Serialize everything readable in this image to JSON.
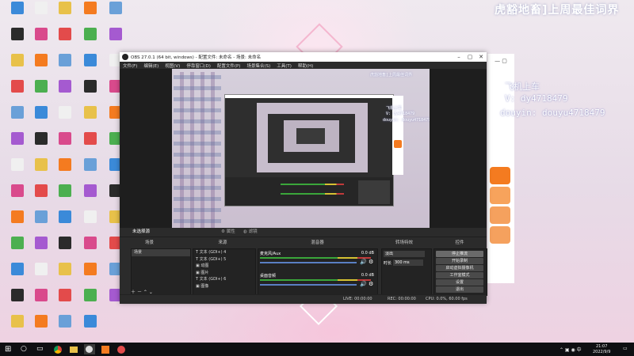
{
  "stream_overlay": {
    "title": "虎豁地畜]上周最佳词界",
    "line1": "飞机上车",
    "line2": "V: dy4718479",
    "line3": "douyin: douyu4718479"
  },
  "desktop_icons": [
    {
      "label": "",
      "icon": "computer-icon",
      "color": "#6aa0d8"
    },
    {
      "label": "",
      "icon": "mail-icon",
      "color": "#3b8ad9"
    },
    {
      "label": "",
      "icon": "file-icon",
      "color": "#f3f3f3"
    },
    {
      "label": "",
      "icon": "app-icon",
      "color": "#e34b4b"
    },
    {
      "label": "",
      "icon": "app-icon",
      "color": "#3a7ad1"
    },
    {
      "label": "",
      "icon": "app-icon",
      "color": "#f0f0f0"
    },
    {
      "label": "",
      "icon": "folder-icon",
      "color": "#e8c14a"
    },
    {
      "label": "",
      "icon": "app-icon",
      "color": "#4caf50"
    },
    {
      "label": "",
      "icon": "app-icon",
      "color": "#ffffff"
    },
    {
      "label": "",
      "icon": "app-icon",
      "color": "#888888"
    },
    {
      "label": "",
      "icon": "app-icon",
      "color": "#e05a5a"
    },
    {
      "label": "",
      "icon": "app-icon",
      "color": "#a55ad0"
    }
  ],
  "obs": {
    "title": "OBS 27.0.1 (64 bit, windows) - 配置文件: 未命名 - 场景: 未命名",
    "menu": [
      "文件(F)",
      "编辑(E)",
      "视图(V)",
      "停靠窗口(D)",
      "配置文件(P)",
      "场景集合(S)",
      "工具(T)",
      "帮助(H)"
    ],
    "no_source": "未选择源",
    "properties": "属性",
    "filters": "滤镜",
    "docks": {
      "scenes": {
        "title": "场景",
        "items": [
          "场景"
        ]
      },
      "sources": {
        "title": "来源",
        "items": [
          "文本 (GDI+) 4",
          "文本 (GDI+) 5",
          "动图",
          "图片",
          "文本 (GDI+) 6",
          "图像"
        ]
      },
      "mixer": {
        "title": "混音器",
        "tracks": [
          {
            "name": "麦克风/Aux",
            "db": "0.0 dB"
          },
          {
            "name": "桌面音频",
            "db": "0.0 dB"
          }
        ]
      },
      "transitions": {
        "title": "转场特效",
        "type": "淡出",
        "duration_label": "时长",
        "duration": "300 ms"
      },
      "controls": {
        "title": "控件",
        "buttons": [
          "停止推流",
          "开始录制",
          "启动虚拟摄像机",
          "工作室模式",
          "设置",
          "退出"
        ]
      }
    },
    "status": {
      "live": "LIVE: 00:00:00",
      "rec": "REC: 00:00:00",
      "cpu": "CPU: 0.0%, 60.00 fps"
    }
  },
  "taskbar": {
    "time": "21:07",
    "date": "2022/9/9",
    "ime": "中"
  }
}
